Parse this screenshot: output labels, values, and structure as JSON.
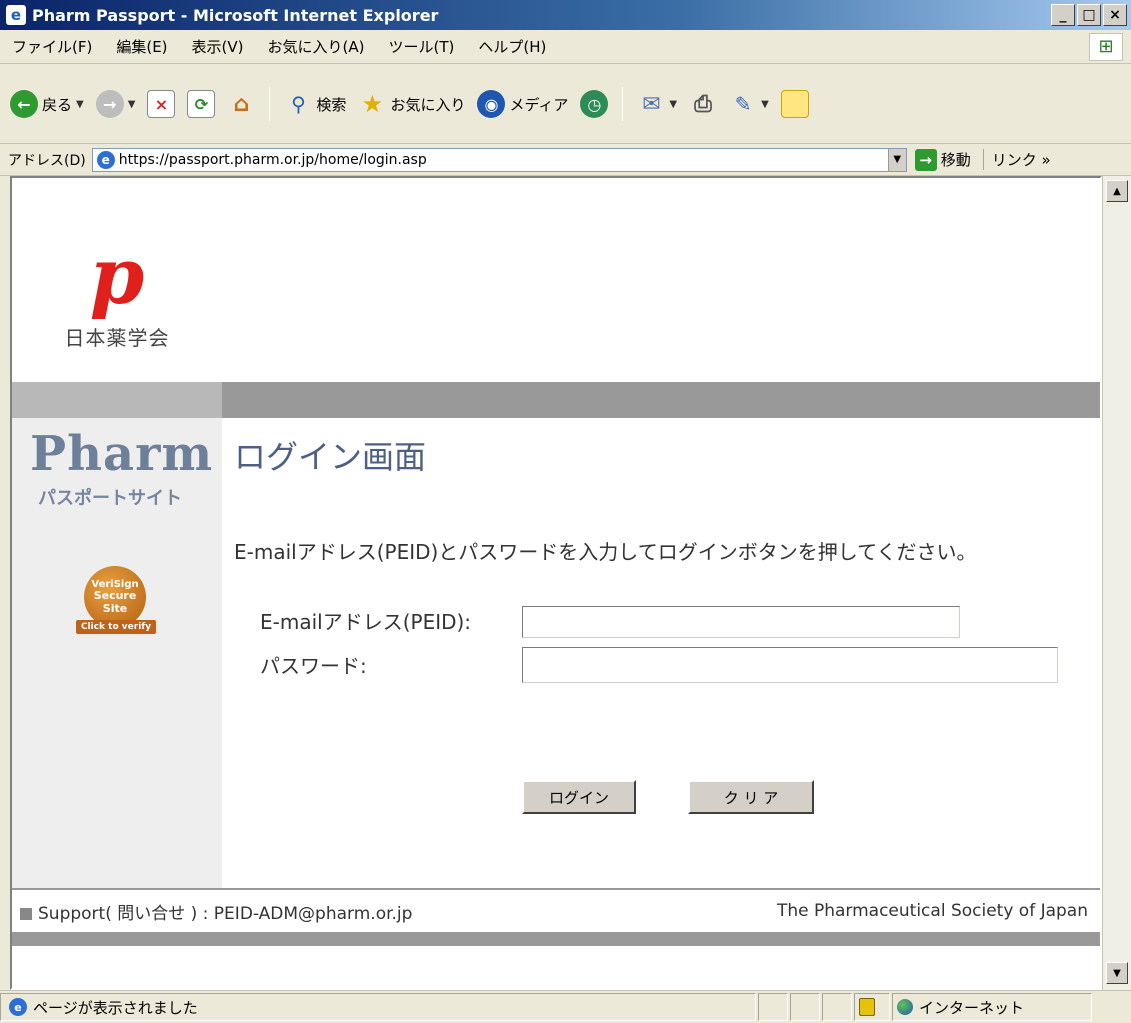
{
  "window": {
    "title": "Pharm Passport - Microsoft Internet Explorer",
    "minimize": "_",
    "maximize": "□",
    "close": "×"
  },
  "menu": [
    "ファイル(F)",
    "編集(E)",
    "表示(V)",
    "お気に入り(A)",
    "ツール(T)",
    "ヘルプ(H)"
  ],
  "toolbar": {
    "back": "戻る",
    "search": "検索",
    "favorites": "お気に入り",
    "media": "メディア"
  },
  "address": {
    "label": "アドレス(D)",
    "url": "https://passport.pharm.or.jp/home/login.asp",
    "go": "移動",
    "links": "リンク »"
  },
  "page": {
    "logo_mark": "p",
    "logo_org": "日本薬学会",
    "pharm_title": "Pharm",
    "pharm_subtitle": "パスポートサイト",
    "verisign": {
      "line1": "VeriSign",
      "line2": "Secure",
      "line3": "Site",
      "click": "Click to verify"
    },
    "heading": "ログイン画面",
    "instruction": "E-mailアドレス(PEID)とパスワードを入力してログインボタンを押してください。",
    "email_label": "E-mailアドレス(PEID):",
    "email_value": "",
    "password_label": "パスワード:",
    "password_value": "",
    "login_button": "ログイン",
    "clear_button": "ク リ ア",
    "footer_support": "Support( 問い合せ ) : PEID-ADM@pharm.or.jp",
    "footer_org": "The Pharmaceutical Society of Japan"
  },
  "status": {
    "text": "ページが表示されました",
    "zone": "インターネット"
  }
}
